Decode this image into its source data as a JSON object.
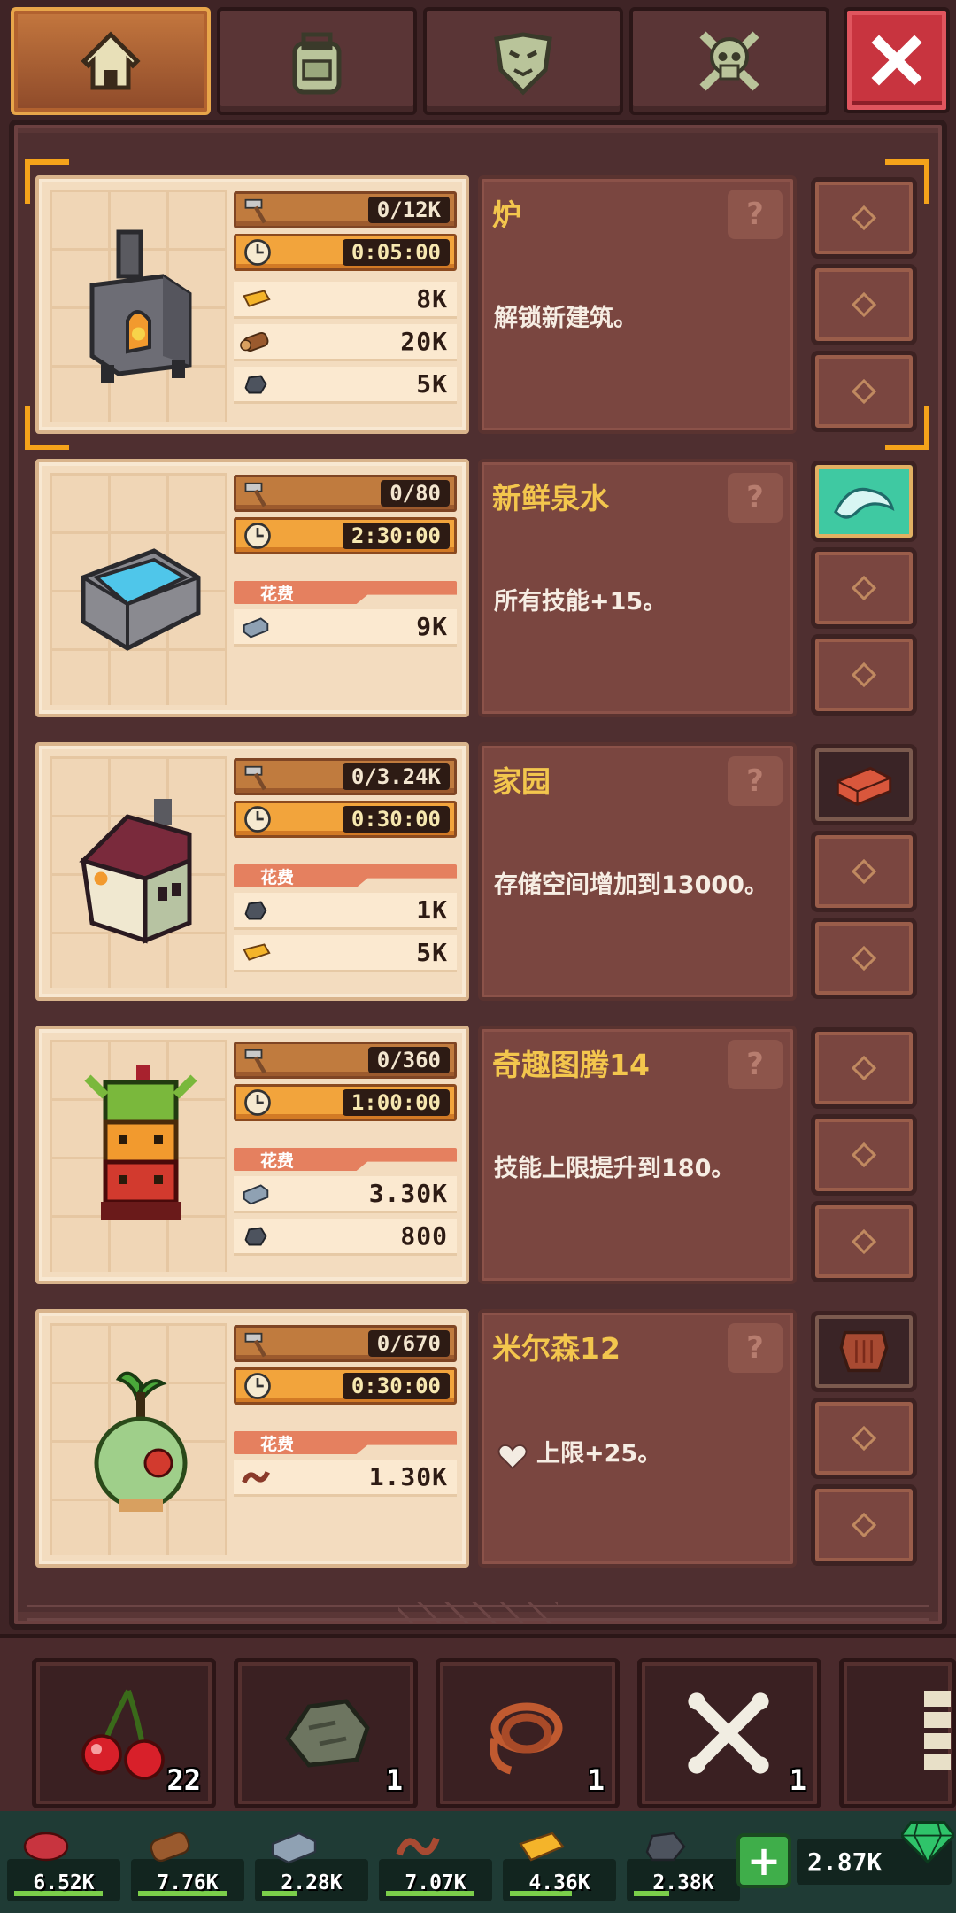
{
  "tabs": [
    {
      "name": "home",
      "icon": "house-icon",
      "active": true
    },
    {
      "name": "backpack",
      "icon": "backpack-icon",
      "active": false
    },
    {
      "name": "shield",
      "icon": "demon-shield-icon",
      "active": false
    },
    {
      "name": "skull",
      "icon": "skull-crossbones-icon",
      "active": false
    }
  ],
  "close_icon": "close-icon",
  "buildings": [
    {
      "name": "炉",
      "progress": "0/12K",
      "time": "0:05:00",
      "cost_label": "",
      "resources": [
        {
          "icon": "gold-ingot-icon",
          "amount": "8K"
        },
        {
          "icon": "wood-log-icon",
          "amount": "20K"
        },
        {
          "icon": "stone-icon",
          "amount": "5K"
        }
      ],
      "description": "解锁新建筑。",
      "help": "?",
      "slots": [
        "empty",
        "empty",
        "empty"
      ]
    },
    {
      "name": "新鲜泉水",
      "progress": "0/80",
      "time": "2:30:00",
      "cost_label": "花费",
      "resources": [
        {
          "icon": "iron-ingot-icon",
          "amount": "9K"
        }
      ],
      "description": "所有技能+15。",
      "help": "?",
      "slots": [
        "water",
        "empty",
        "empty"
      ]
    },
    {
      "name": "家园",
      "progress": "0/3.24K",
      "time": "0:30:00",
      "cost_label": "花费",
      "resources": [
        {
          "icon": "stone-icon",
          "amount": "1K"
        },
        {
          "icon": "gold-ingot-icon",
          "amount": "5K"
        }
      ],
      "description": "存储空间增加到13000。",
      "help": "?",
      "slots": [
        "brick",
        "empty",
        "empty"
      ]
    },
    {
      "name": "奇趣图腾14",
      "progress": "0/360",
      "time": "1:00:00",
      "cost_label": "花费",
      "resources": [
        {
          "icon": "iron-ingot-icon",
          "amount": "3.30K"
        },
        {
          "icon": "stone-icon",
          "amount": "800"
        }
      ],
      "description": "技能上限提升到180。",
      "help": "?",
      "slots": [
        "empty",
        "empty",
        "empty"
      ]
    },
    {
      "name": "米尔森12",
      "progress": "0/670",
      "time": "0:30:00",
      "cost_label": "花费",
      "resources": [
        {
          "icon": "leather-rope-icon",
          "amount": "1.30K"
        }
      ],
      "description": "上限+25。",
      "help": "?",
      "slots": [
        "leather",
        "empty",
        "empty"
      ]
    }
  ],
  "inventory": [
    {
      "item": "cherry-icon",
      "count": "22"
    },
    {
      "item": "ore-rock-icon",
      "count": "1"
    },
    {
      "item": "rope-icon",
      "count": "1"
    },
    {
      "item": "bone-icon",
      "count": "1"
    },
    {
      "item": "spine-icon",
      "count": ""
    }
  ],
  "currencies": [
    {
      "icon": "meat-icon",
      "value": "6.52K"
    },
    {
      "icon": "wood-log-icon",
      "value": "7.76K"
    },
    {
      "icon": "iron-ingot-icon",
      "value": "2.28K"
    },
    {
      "icon": "leather-rope-icon",
      "value": "7.07K"
    },
    {
      "icon": "gold-ingot-icon",
      "value": "4.36K"
    },
    {
      "icon": "stone-icon",
      "value": "2.38K"
    }
  ],
  "plus_label": "+",
  "gems": {
    "icon": "gem-icon",
    "value": "2.87K"
  }
}
